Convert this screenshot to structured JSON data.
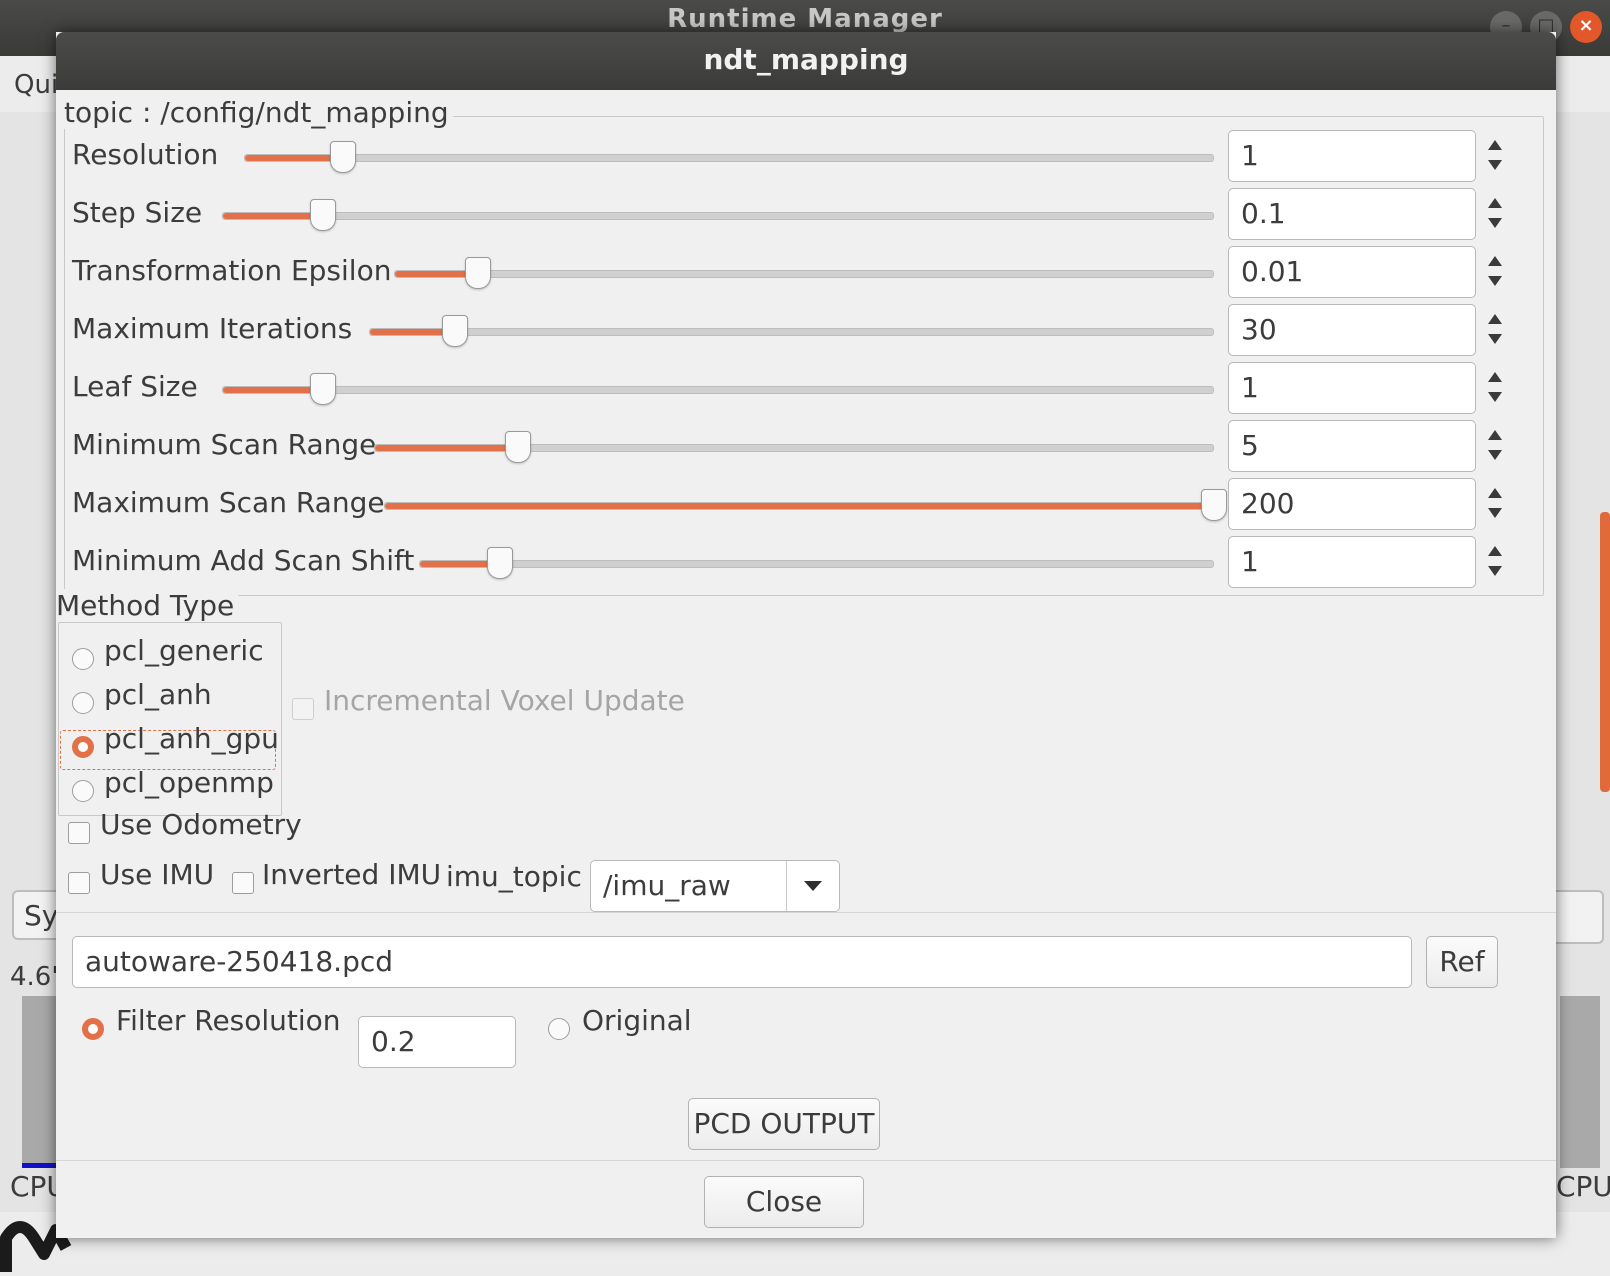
{
  "background": {
    "title": "Runtime Manager",
    "menu_text": "Qui",
    "side_button_text": "Sy",
    "percent_text": "4.6'",
    "cpu_left": "CPU",
    "cpu_right": "CPU"
  },
  "dialog": {
    "title": "ndt_mapping",
    "topic_label": "topic : /config/ndt_mapping",
    "params": [
      {
        "label": "Resolution",
        "value": "1",
        "fill": 0.1
      },
      {
        "label": "Step Size",
        "value": "0.1",
        "fill": 0.1
      },
      {
        "label": "Transformation Epsilon",
        "value": "0.01",
        "fill": 0.1
      },
      {
        "label": "Maximum Iterations",
        "value": "30",
        "fill": 0.1
      },
      {
        "label": "Leaf Size",
        "value": "1",
        "fill": 0.1
      },
      {
        "label": "Minimum Scan Range",
        "value": "5",
        "fill": 0.17
      },
      {
        "label": "Maximum Scan Range",
        "value": "200",
        "fill": 1.0
      },
      {
        "label": "Minimum Add Scan Shift",
        "value": "1",
        "fill": 0.1
      }
    ],
    "method_type": {
      "label": "Method Type",
      "options": [
        "pcl_generic",
        "pcl_anh",
        "pcl_anh_gpu",
        "pcl_openmp"
      ],
      "selected": "pcl_anh_gpu"
    },
    "incremental_voxel_label": "Incremental Voxel Update",
    "use_odometry_label": "Use Odometry",
    "use_imu_label": "Use IMU",
    "inverted_imu_label": "Inverted IMU",
    "imu_topic_label": "imu_topic",
    "imu_topic_value": "/imu_raw",
    "pcd_file_value": "autoware-250418.pcd",
    "ref_label": "Ref",
    "filter_resolution_label": "Filter Resolution",
    "filter_resolution_value": "0.2",
    "original_label": "Original",
    "pcd_output_label": "PCD OUTPUT",
    "close_label": "Close"
  }
}
